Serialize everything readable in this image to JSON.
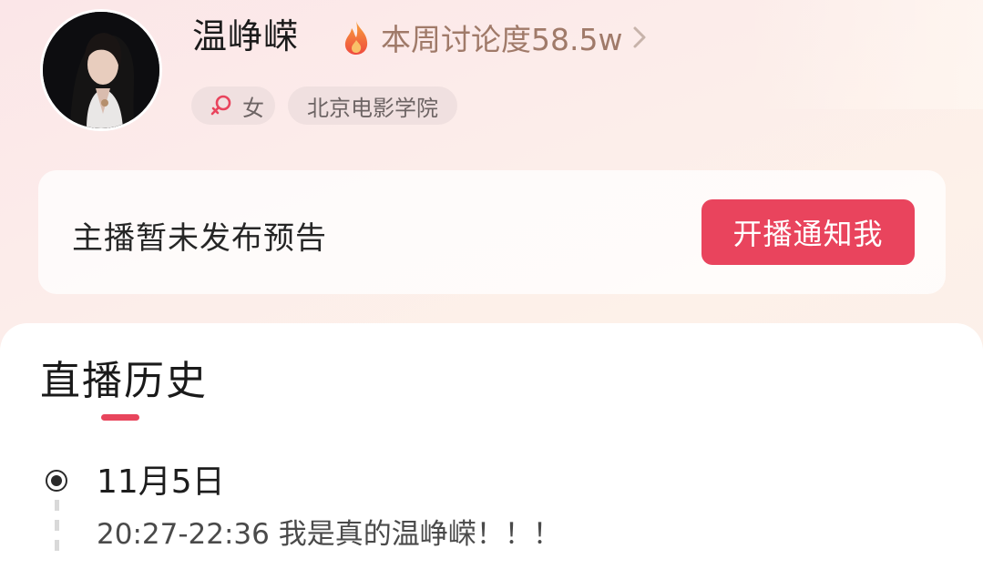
{
  "profile": {
    "name": "温峥嵘",
    "heat_label": "本周讨论度58.5w",
    "tags": {
      "gender": "女",
      "school": "北京电影学院"
    }
  },
  "notice": {
    "text": "主播暂未发布预告",
    "button_label": "开播通知我"
  },
  "history": {
    "title": "直播历史",
    "entries": [
      {
        "date": "11月5日",
        "detail": "20:27-22:36 我是真的温峥嵘！！！"
      }
    ]
  },
  "colors": {
    "accent": "#e9445d",
    "heat_text": "#a07a69"
  },
  "icons": {
    "heat": "fire-icon",
    "more": "chevron-right-icon",
    "gender": "female-symbol-icon",
    "timeline": "timeline-dot-icon"
  }
}
